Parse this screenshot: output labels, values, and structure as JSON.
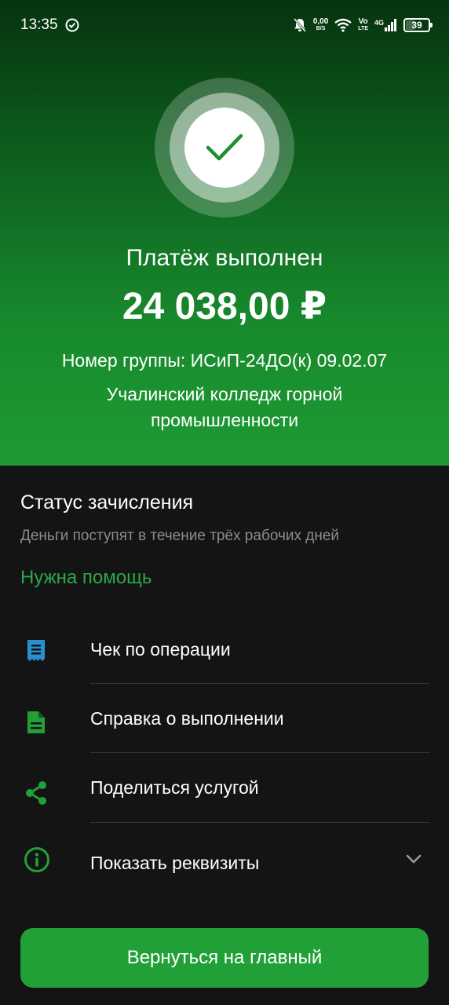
{
  "status_bar": {
    "time": "13:35",
    "net_speed": "0,00",
    "net_speed_unit": "B/S",
    "volte_top": "Vo",
    "volte_bottom": "LTE",
    "network": "4G",
    "battery": "39"
  },
  "hero": {
    "title": "Платёж выполнен",
    "amount": "24 038,00 ₽",
    "group": "Номер группы: ИСиП-24ДО(к) 09.02.07",
    "organization": "Учалинский колледж горной промышленности",
    "icon": "checkmark-icon"
  },
  "status": {
    "title": "Статус зачисления",
    "subtitle": "Деньги поступят в течение трёх рабочих дней"
  },
  "help": {
    "label": "Нужна помощь"
  },
  "actions": [
    {
      "label": "Чек по операции",
      "icon": "receipt-icon",
      "color": "#2a8fd1"
    },
    {
      "label": "Справка о выполнении",
      "icon": "document-icon",
      "color": "#21a038"
    },
    {
      "label": "Поделиться услугой",
      "icon": "share-icon",
      "color": "#21a038"
    },
    {
      "label": "Показать реквизиты",
      "icon": "info-icon",
      "color": "#21a038"
    }
  ],
  "cta": {
    "label": "Вернуться на главный"
  },
  "colors": {
    "accent": "#21a038",
    "link": "#2ba84a",
    "background": "#141414"
  }
}
